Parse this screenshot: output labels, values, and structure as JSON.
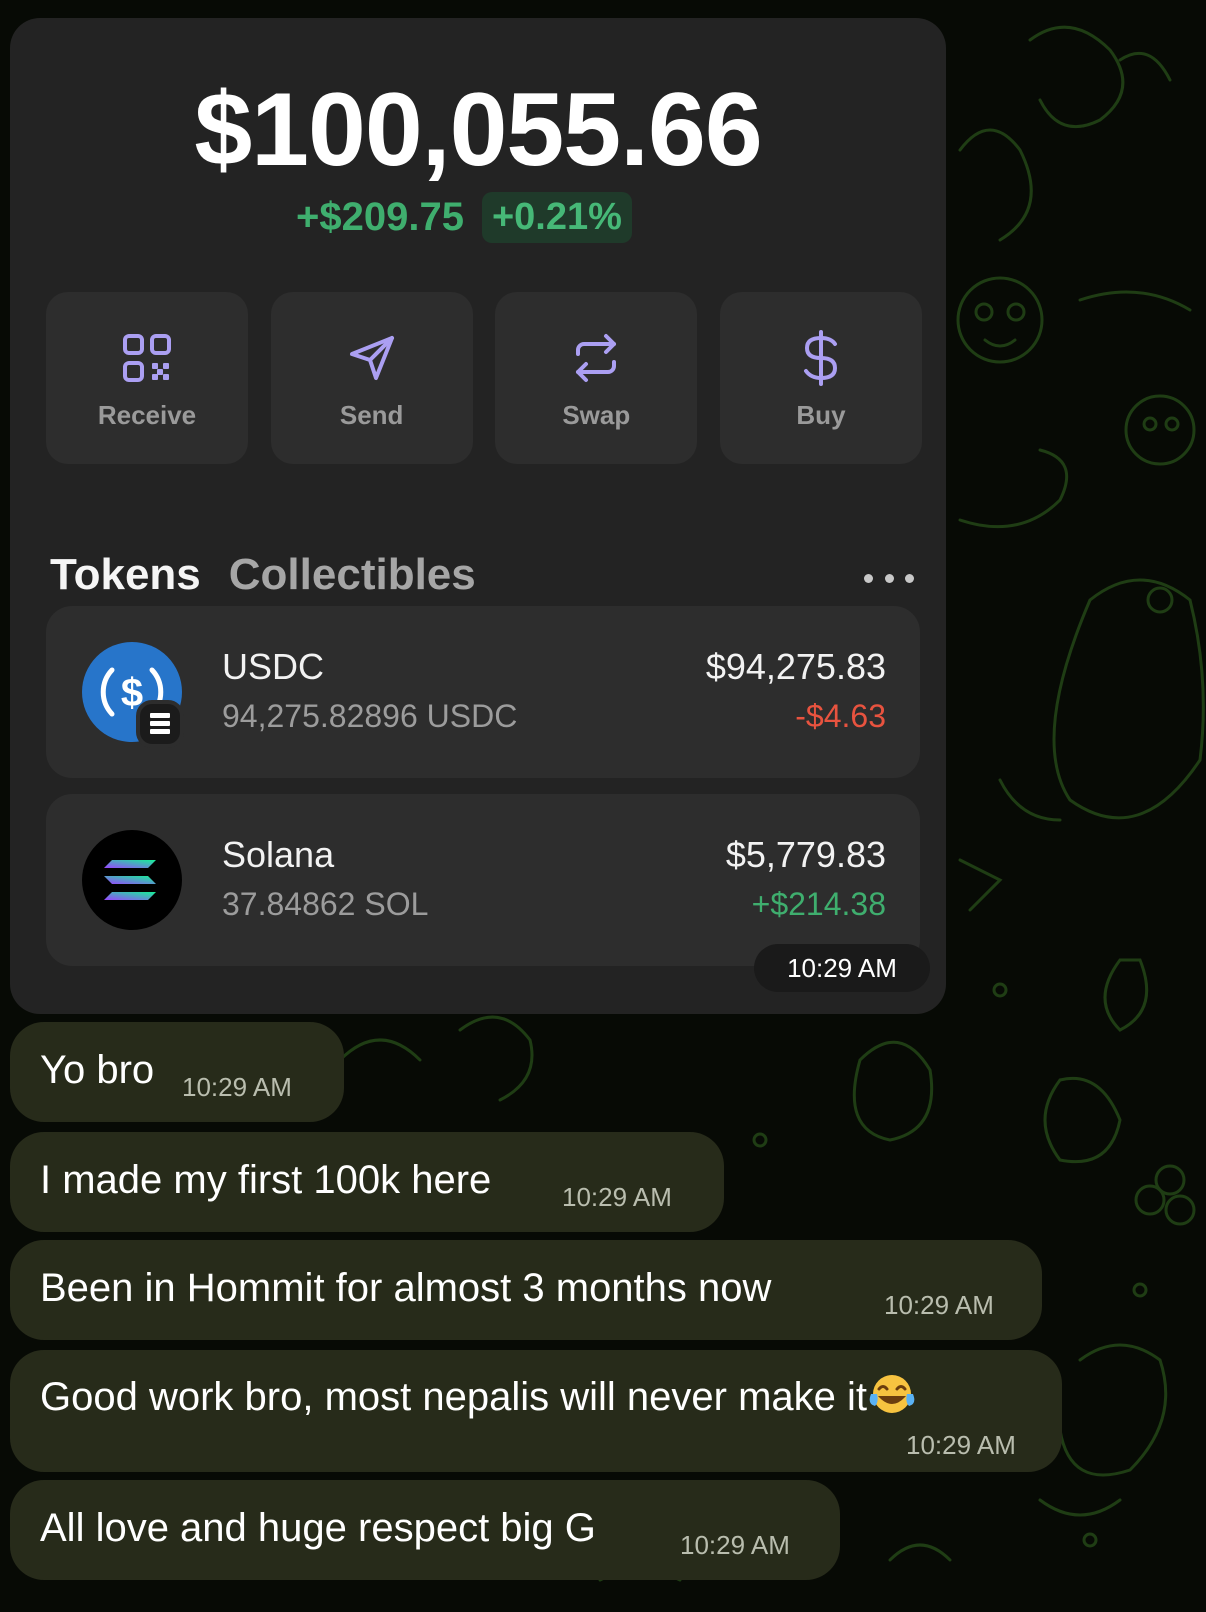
{
  "wallet": {
    "balance": "$100,055.66",
    "change_amount": "+$209.75",
    "change_percent": "+0.21%",
    "actions": [
      {
        "label": "Receive",
        "icon": "qr-code-icon"
      },
      {
        "label": "Send",
        "icon": "send-icon"
      },
      {
        "label": "Swap",
        "icon": "swap-icon"
      },
      {
        "label": "Buy",
        "icon": "dollar-icon"
      }
    ],
    "tabs": {
      "active": "Tokens",
      "inactive": "Collectibles"
    },
    "tokens": [
      {
        "name": "USDC",
        "quantity": "94,275.82896 USDC",
        "value": "$94,275.83",
        "change": "-$4.63",
        "change_color": "#e8533f",
        "icon": "usdc-icon"
      },
      {
        "name": "Solana",
        "quantity": "37.84862 SOL",
        "value": "$5,779.83",
        "change": "+$214.38",
        "change_color": "#3fae6e",
        "icon": "solana-icon"
      }
    ],
    "timestamp": "10:29 AM"
  },
  "messages": [
    {
      "text": "Yo bro",
      "time": "10:29 AM"
    },
    {
      "text": "I made my first 100k here",
      "time": "10:29 AM"
    },
    {
      "text": "Been in Hommit for almost 3 months now",
      "time": "10:29 AM"
    },
    {
      "text": "Good work bro, most nepalis will never make it",
      "time": "10:29 AM",
      "emoji": "laughing-tears-emoji"
    },
    {
      "text": "All love and huge respect big G",
      "time": "10:29 AM"
    }
  ],
  "colors": {
    "accent": "#ab9ff2",
    "positive": "#3fae6e",
    "negative": "#e8533f",
    "bubble": "#272b1a",
    "card": "#232323"
  }
}
